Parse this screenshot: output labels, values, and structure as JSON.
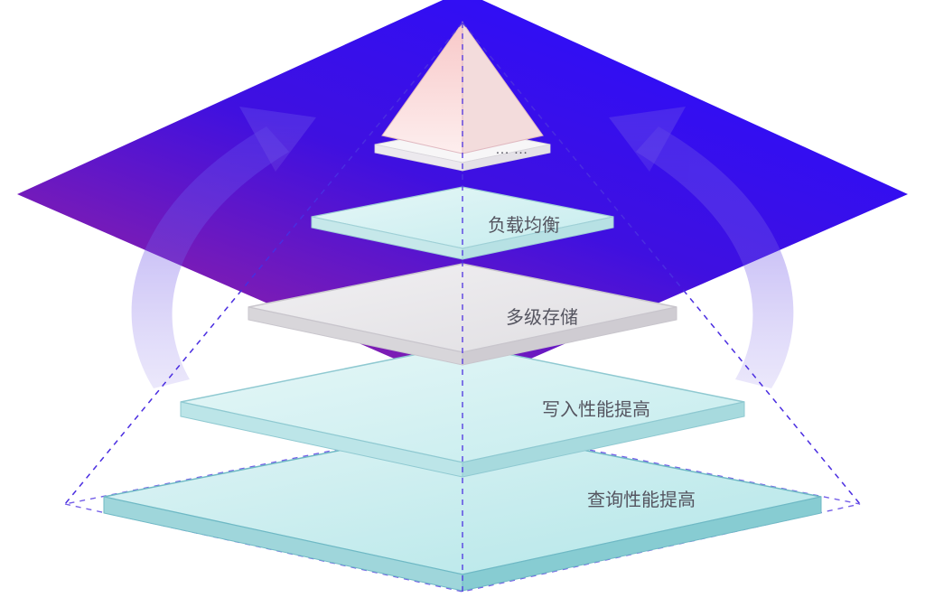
{
  "pyramid": {
    "layers": [
      {
        "label": "查询性能提高"
      },
      {
        "label": "写入性能提高"
      },
      {
        "label": "多级存储"
      },
      {
        "label": "负载均衡"
      },
      {
        "label": "… …"
      }
    ]
  }
}
